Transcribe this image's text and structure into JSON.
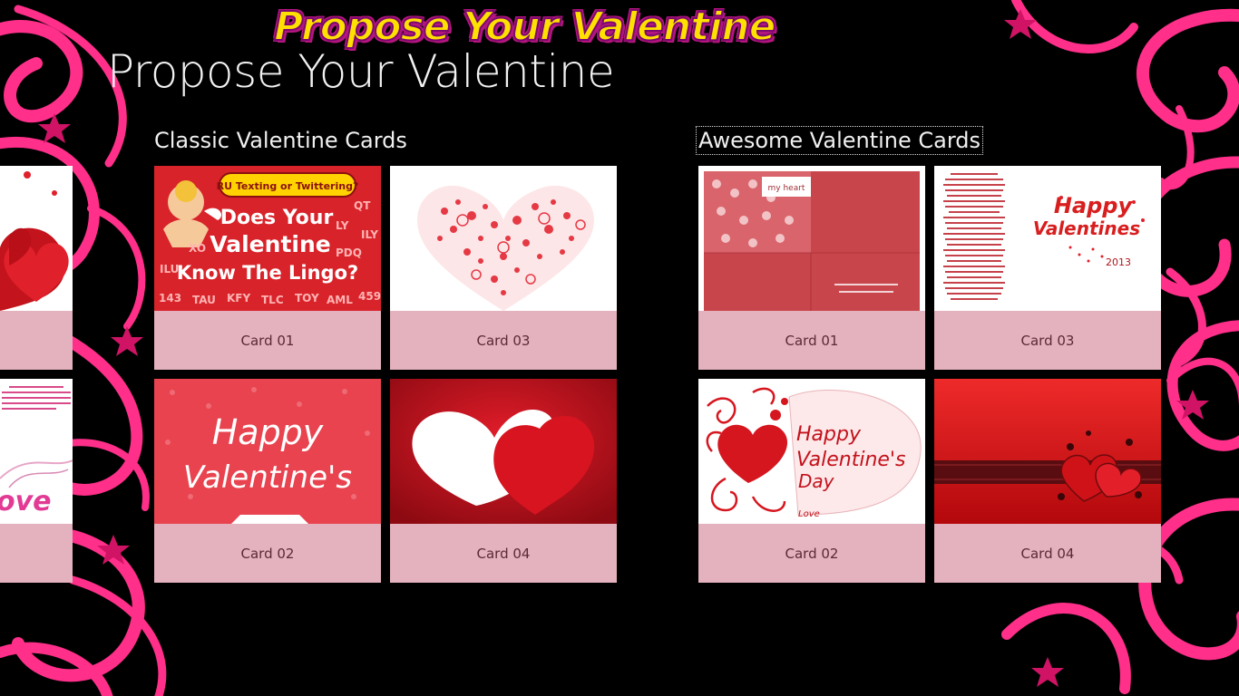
{
  "app": {
    "logo_text": "Propose Your Valentine",
    "title": "Propose Your Valentine"
  },
  "groups": [
    {
      "header": "Classic Valentine Cards",
      "tiles": [
        {
          "label": "Card 01",
          "image": "cupid-lingo-card"
        },
        {
          "label": "Card 02",
          "image": "happy-valentines-pink-card"
        },
        {
          "label": "Card 03",
          "image": "heart-pattern-card"
        },
        {
          "label": "Card 04",
          "image": "paper-hearts-card"
        }
      ]
    },
    {
      "header": "Awesome Valentine Cards",
      "tiles": [
        {
          "label": "Card 01",
          "image": "folded-letter-card"
        },
        {
          "label": "Card 02",
          "image": "happy-valentines-day-swirl-card"
        },
        {
          "label": "Card 03",
          "image": "poem-happy-valentines-card"
        },
        {
          "label": "Card 04",
          "image": "red-hearts-banner-card"
        }
      ]
    }
  ],
  "card_art_text": {
    "c1_banner": "RU Texting or Twittering?",
    "c1_l1": "Does Your",
    "c1_l2": "Valentine",
    "c1_l3": "Know The Lingo?",
    "c1_t1": "143",
    "c1_t2": "TAU",
    "c1_t3": "KFY",
    "c1_t4": "TLC",
    "c1_t5": "TOY",
    "c1_t6": "AML",
    "c1_t7": "459",
    "c1_s1": "QT",
    "c1_s2": "LY",
    "c1_s3": "ILY",
    "c1_s4": "PDQ",
    "c1_s5": "XO",
    "c1_s6": "ILU",
    "c2_l1": "Happy",
    "c2_l2": "Valentine's",
    "a2_l1": "Happy",
    "a2_l2": "Valentine's",
    "a2_l3": "Day",
    "a2_l4": "Love",
    "a3_l1": "Happy",
    "a3_l2": "Valentines",
    "a3_year": "2013",
    "a1_note": "my heart",
    "partial_text": "ove"
  }
}
